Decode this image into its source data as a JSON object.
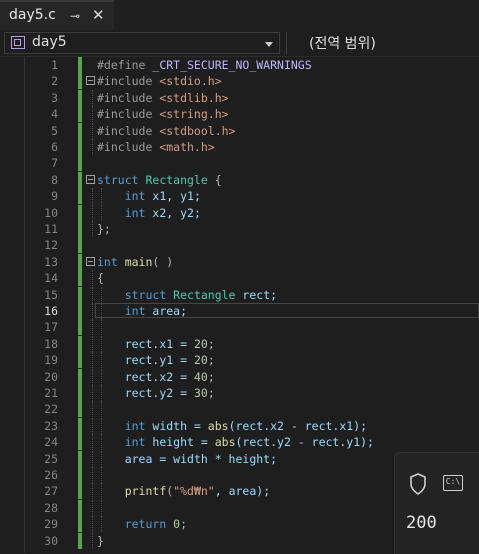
{
  "tab": {
    "title": "day5.c",
    "pin": "⊸",
    "close": "✕"
  },
  "navbar": {
    "project": "day5",
    "scope": "(전역 범위)"
  },
  "editor": {
    "current_line": 16,
    "lines": [
      [
        {
          "t": "#define ",
          "c": "pre"
        },
        {
          "t": "_CRT_SECURE_NO_WARNINGS",
          "c": "macro"
        }
      ],
      [
        {
          "t": "#include ",
          "c": "pre"
        },
        {
          "t": "<stdio.h>",
          "c": "str"
        }
      ],
      [
        {
          "t": "#include ",
          "c": "pre"
        },
        {
          "t": "<stdlib.h>",
          "c": "str"
        }
      ],
      [
        {
          "t": "#include ",
          "c": "pre"
        },
        {
          "t": "<string.h>",
          "c": "str"
        }
      ],
      [
        {
          "t": "#include ",
          "c": "pre"
        },
        {
          "t": "<stdbool.h>",
          "c": "str"
        }
      ],
      [
        {
          "t": "#include ",
          "c": "pre"
        },
        {
          "t": "<math.h>",
          "c": "str"
        }
      ],
      [],
      [
        {
          "t": "struct ",
          "c": "kw"
        },
        {
          "t": "Rectangle",
          "c": "type"
        },
        {
          "t": " {",
          "c": "op"
        }
      ],
      [
        {
          "t": "    "
        },
        {
          "t": "int ",
          "c": "kw"
        },
        {
          "t": "x1, y1;",
          "c": "var"
        }
      ],
      [
        {
          "t": "    "
        },
        {
          "t": "int ",
          "c": "kw"
        },
        {
          "t": "x2, y2;",
          "c": "var"
        }
      ],
      [
        {
          "t": "};",
          "c": "op"
        }
      ],
      [],
      [
        {
          "t": "int ",
          "c": "kw"
        },
        {
          "t": "main",
          "c": "fn"
        },
        {
          "t": "( )",
          "c": "op"
        }
      ],
      [
        {
          "t": "{",
          "c": "op"
        }
      ],
      [
        {
          "t": "    "
        },
        {
          "t": "struct ",
          "c": "kw"
        },
        {
          "t": "Rectangle ",
          "c": "type"
        },
        {
          "t": "rect;",
          "c": "var"
        }
      ],
      [
        {
          "t": "    "
        },
        {
          "t": "int ",
          "c": "kw"
        },
        {
          "t": "area;",
          "c": "var"
        }
      ],
      [],
      [
        {
          "t": "    "
        },
        {
          "t": "rect.x1 = ",
          "c": "var"
        },
        {
          "t": "20",
          "c": "num"
        },
        {
          "t": ";",
          "c": "op"
        }
      ],
      [
        {
          "t": "    "
        },
        {
          "t": "rect.y1 = ",
          "c": "var"
        },
        {
          "t": "20",
          "c": "num"
        },
        {
          "t": ";",
          "c": "op"
        }
      ],
      [
        {
          "t": "    "
        },
        {
          "t": "rect.x2 = ",
          "c": "var"
        },
        {
          "t": "40",
          "c": "num"
        },
        {
          "t": ";",
          "c": "op"
        }
      ],
      [
        {
          "t": "    "
        },
        {
          "t": "rect.y2 = ",
          "c": "var"
        },
        {
          "t": "30",
          "c": "num"
        },
        {
          "t": ";",
          "c": "op"
        }
      ],
      [],
      [
        {
          "t": "    "
        },
        {
          "t": "int ",
          "c": "kw"
        },
        {
          "t": "width = ",
          "c": "var"
        },
        {
          "t": "abs",
          "c": "fn"
        },
        {
          "t": "(rect.x2 - rect.x1);",
          "c": "var"
        }
      ],
      [
        {
          "t": "    "
        },
        {
          "t": "int ",
          "c": "kw"
        },
        {
          "t": "height = ",
          "c": "var"
        },
        {
          "t": "abs",
          "c": "fn"
        },
        {
          "t": "(rect.y2 - rect.y1);",
          "c": "var"
        }
      ],
      [
        {
          "t": "    "
        },
        {
          "t": "area = width * height;",
          "c": "var"
        }
      ],
      [],
      [
        {
          "t": "    "
        },
        {
          "t": "printf",
          "c": "fn"
        },
        {
          "t": "(",
          "c": "op"
        },
        {
          "t": "\"%d₩n\"",
          "c": "str"
        },
        {
          "t": ", area);",
          "c": "var"
        }
      ],
      [],
      [
        {
          "t": "    "
        },
        {
          "t": "return ",
          "c": "kw"
        },
        {
          "t": "0",
          "c": "num"
        },
        {
          "t": ";",
          "c": "op"
        }
      ],
      [
        {
          "t": "}",
          "c": "op"
        }
      ]
    ]
  },
  "output": {
    "value": "200",
    "terminal_glyph": "C:\\"
  },
  "colors": {
    "change_bar": "#57a64a",
    "background": "#1e1e1e"
  }
}
